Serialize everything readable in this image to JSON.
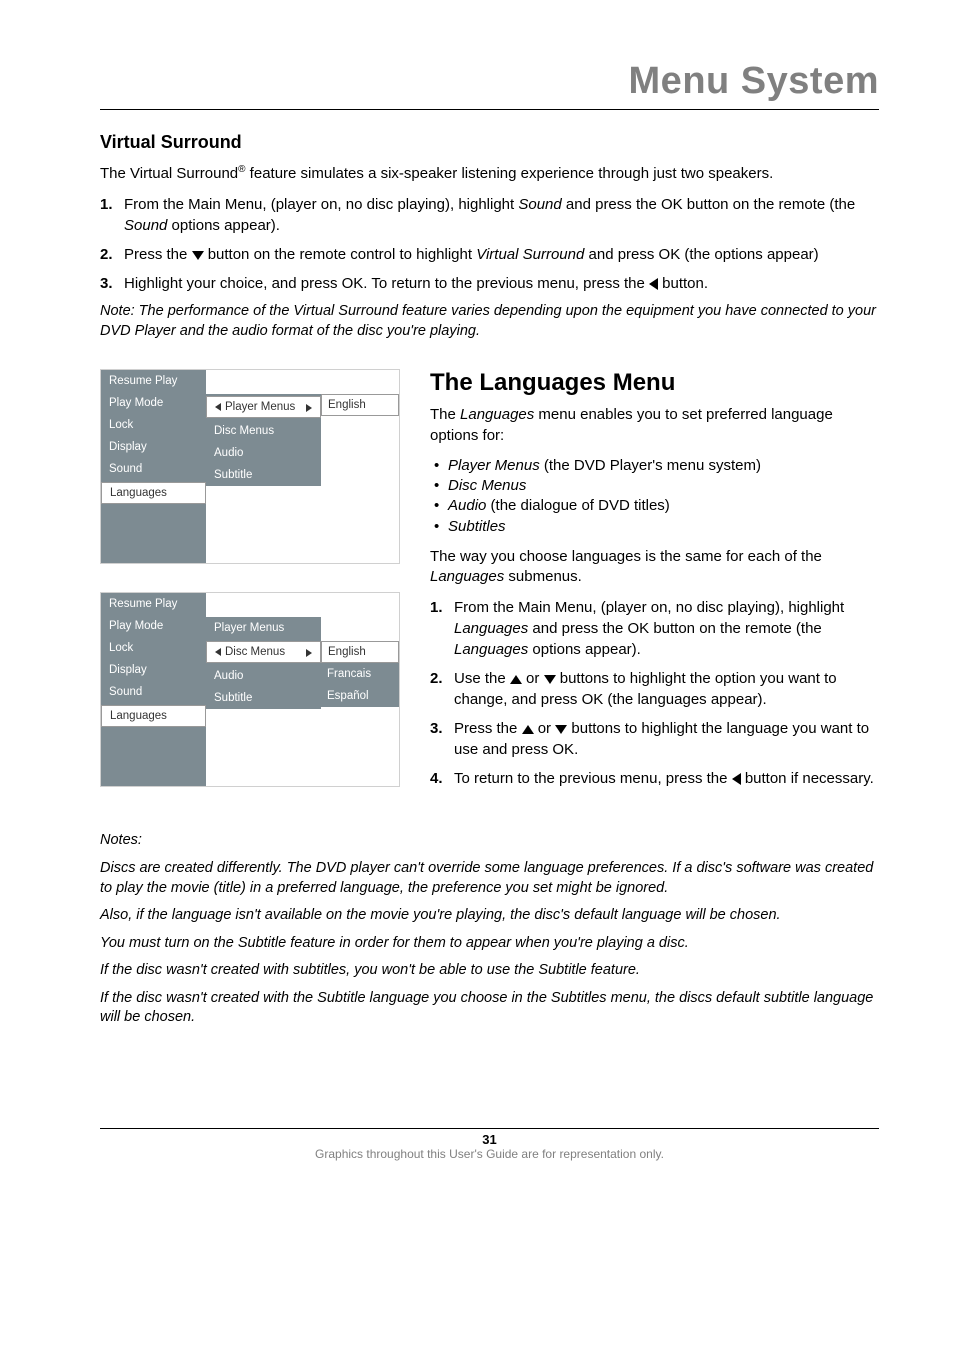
{
  "header": {
    "title": "Menu System"
  },
  "virtual_surround": {
    "heading": "Virtual Surround",
    "intro_pre": "The Virtual Surround",
    "intro_sup": "®",
    "intro_post": " feature simulates a six-speaker listening experience through just two speakers.",
    "step1_num": "1.",
    "step1_a": "From the Main Menu, (player on, no disc playing), highlight ",
    "step1_i": "Sound",
    "step1_b": " and press the OK button on the remote (the ",
    "step1_i2": "Sound",
    "step1_c": " options appear).",
    "step2_num": "2.",
    "step2_a": "Press the ",
    "step2_b": " button on the remote control to highlight ",
    "step2_i": "Virtual Surround",
    "step2_c": " and press OK (the options appear)",
    "step3_num": "3.",
    "step3_a": "Highlight your choice, and press OK. To return to the previous menu, press the ",
    "step3_b": " button.",
    "note": "Note: The performance of the Virtual Surround feature varies depending upon the equipment you have connected to your DVD Player and the audio format of the disc you're playing."
  },
  "menu_shot_1": {
    "side": [
      "Resume Play",
      "Play Mode",
      "Lock",
      "Display",
      "Sound",
      "Languages"
    ],
    "side_selected_index": 5,
    "sub": [
      "Player Menus",
      "Disc Menus",
      "Audio",
      "Subtitle"
    ],
    "sub_selected_index": 0,
    "val": [
      "English"
    ],
    "val_selected_index": 0
  },
  "menu_shot_2": {
    "side": [
      "Resume Play",
      "Play Mode",
      "Lock",
      "Display",
      "Sound",
      "Languages"
    ],
    "side_selected_index": 5,
    "sub": [
      "Player Menus",
      "Disc Menus",
      "Audio",
      "Subtitle"
    ],
    "sub_selected_index": 1,
    "val": [
      "English",
      "Francais",
      "Español"
    ],
    "val_selected_index": 0
  },
  "languages": {
    "heading": "The Languages Menu",
    "intro_a": "The ",
    "intro_i": "Languages",
    "intro_b": " menu enables you to set preferred language options for:",
    "bullet1_i": "Player Menus",
    "bullet1_t": " (the DVD Player's menu system)",
    "bullet2_i": "Disc Menus",
    "bullet3_i": "Audio",
    "bullet3_t": " (the dialogue of DVD titles)",
    "bullet4_i": "Subtitles",
    "way_a": "The way you choose languages is the same for each of the ",
    "way_i": "Languages",
    "way_b": " submenus.",
    "s1_num": "1.",
    "s1_a": "From the Main Menu, (player on, no disc playing), highlight ",
    "s1_i": "Languages",
    "s1_b": " and press the OK button on the remote (the ",
    "s1_i2": "Languages",
    "s1_c": " options appear).",
    "s2_num": "2.",
    "s2_a": "Use the ",
    "s2_b": " or ",
    "s2_c": " buttons to highlight the option you want to change, and press OK (the languages appear).",
    "s3_num": "3.",
    "s3_a": "Press the ",
    "s3_b": " or ",
    "s3_c": " buttons to highlight the language you want to use and press OK.",
    "s4_num": "4.",
    "s4_a": "To return to the previous menu, press the ",
    "s4_b": " button if necessary."
  },
  "notes": {
    "heading": "Notes:",
    "n1": "Discs are created differently. The DVD player can't override some language preferences. If a disc's software was created to play the movie (title) in a preferred language, the preference you set might be ignored.",
    "n2": "Also, if the language isn't available on the movie you're playing, the disc's default language will be chosen.",
    "n3": "You must turn on the Subtitle feature in order for them to appear when you're playing a disc.",
    "n4": "If the disc wasn't created with subtitles, you won't be able to use the Subtitle feature.",
    "n5": "If the disc wasn't created with the Subtitle language you choose in the Subtitles menu, the discs default subtitle language will be chosen."
  },
  "footer": {
    "page": "31",
    "caption": "Graphics throughout this User's Guide are for representation only."
  }
}
